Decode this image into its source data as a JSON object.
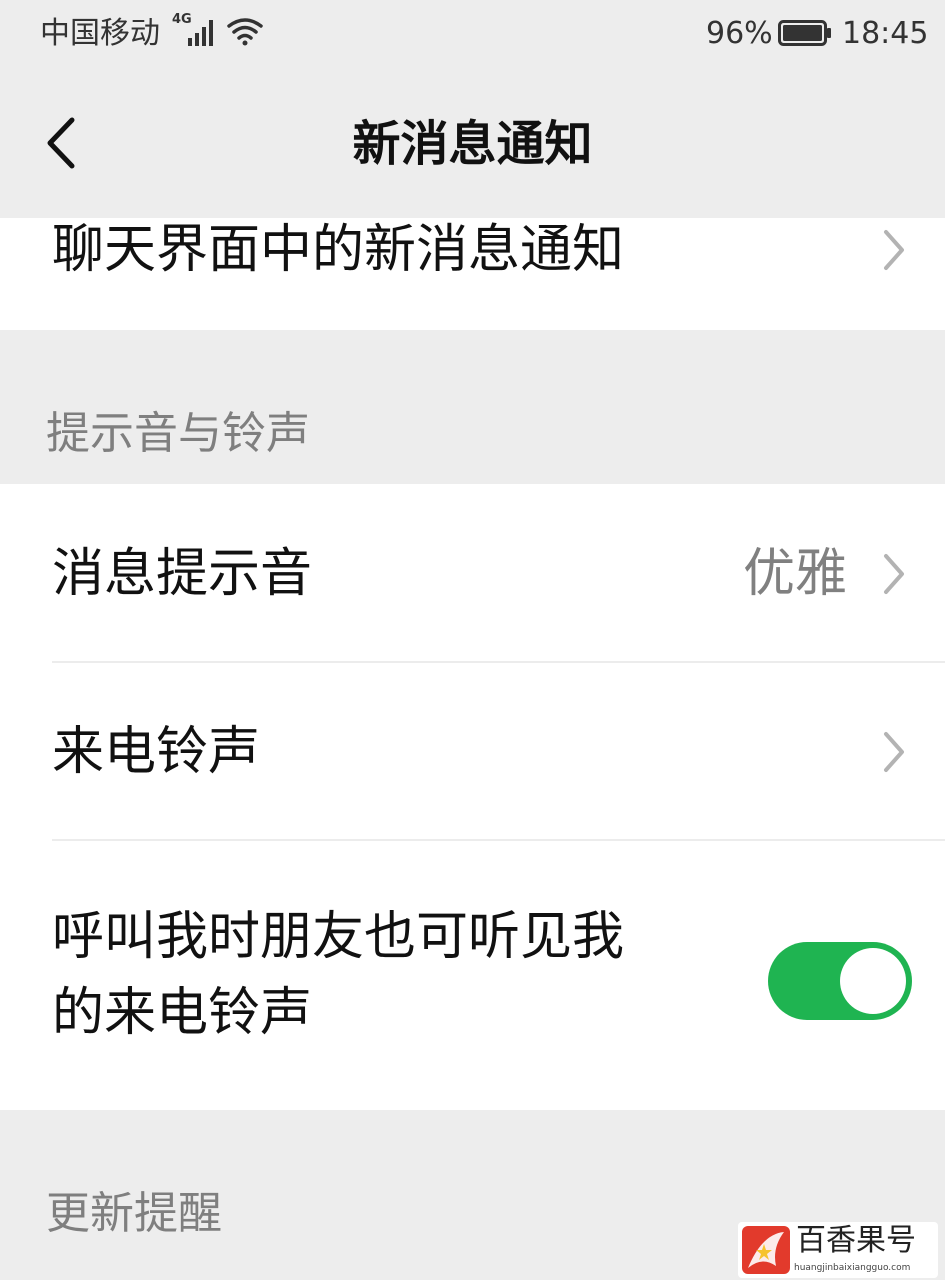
{
  "status_bar": {
    "carrier": "中国移动",
    "network_type": "4G",
    "battery_percent": "96%",
    "time": "18:45"
  },
  "nav": {
    "title": "新消息通知",
    "back_icon": "chevron-left-icon"
  },
  "rows": {
    "chat_notifications": "聊天界面中的新消息通知",
    "message_sound": "消息提示音",
    "message_sound_value": "优雅",
    "ringtone": "来电铃声",
    "friends_hear_ringtone_line1": "呼叫我时朋友也可听见我",
    "friends_hear_ringtone_line2": "的来电铃声",
    "friends_hear_ringtone_enabled": true
  },
  "sections": {
    "sounds": "提示音与铃声",
    "updates": "更新提醒"
  },
  "watermark": {
    "title": "百香果号",
    "url": "huangjinbaixiangguo.com"
  },
  "colors": {
    "background": "#ededed",
    "card": "#ffffff",
    "toggle_on": "#1fb451",
    "secondary_text": "#808080"
  }
}
